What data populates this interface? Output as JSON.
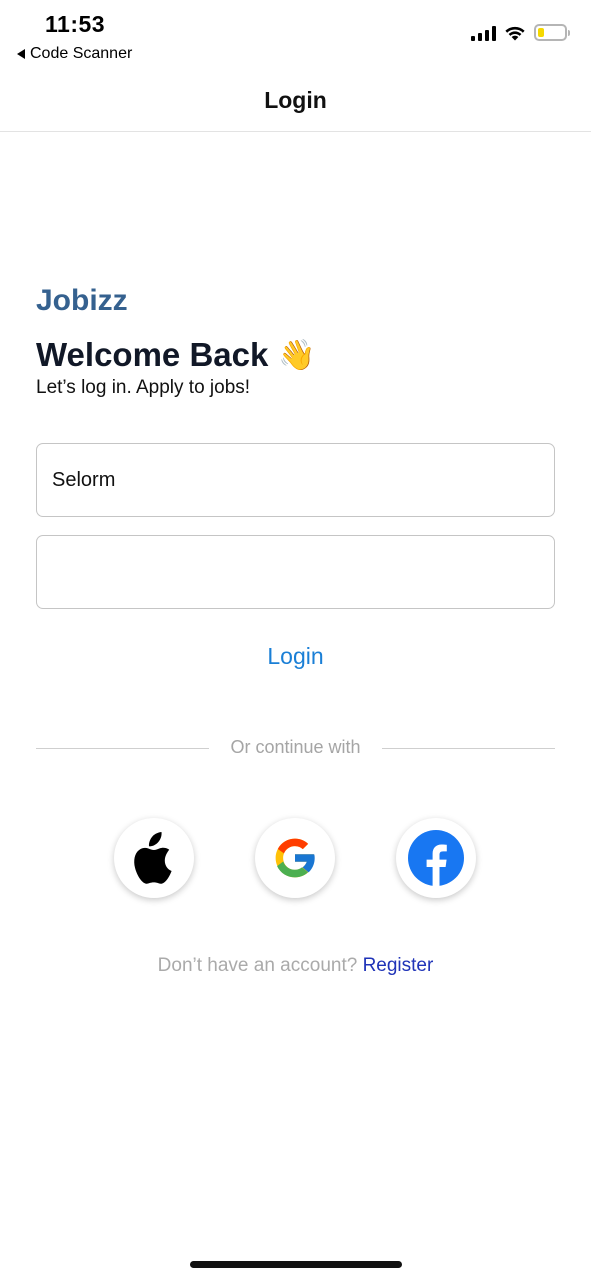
{
  "status_bar": {
    "time": "11:53",
    "back_app": "Code Scanner",
    "battery_level_percent": 25,
    "battery_color": "#f5d800",
    "icons": [
      "signal-icon",
      "wifi-icon",
      "battery-icon"
    ]
  },
  "nav": {
    "title": "Login"
  },
  "brand": {
    "name": "Jobizz",
    "color": "#35618f"
  },
  "welcome": {
    "title": "Welcome Back",
    "emoji": "👋",
    "subtitle": "Let’s log in. Apply to jobs!"
  },
  "form": {
    "username_value": "Selorm",
    "password_value": "",
    "login_label": "Login",
    "accent_color": "#1a7fd6"
  },
  "divider": {
    "label": "Or continue with"
  },
  "social": {
    "providers": [
      "apple-icon",
      "google-icon",
      "facebook-icon"
    ]
  },
  "register": {
    "prompt": "Don’t have an account?",
    "link": "Register",
    "link_color": "#1f33b8"
  }
}
